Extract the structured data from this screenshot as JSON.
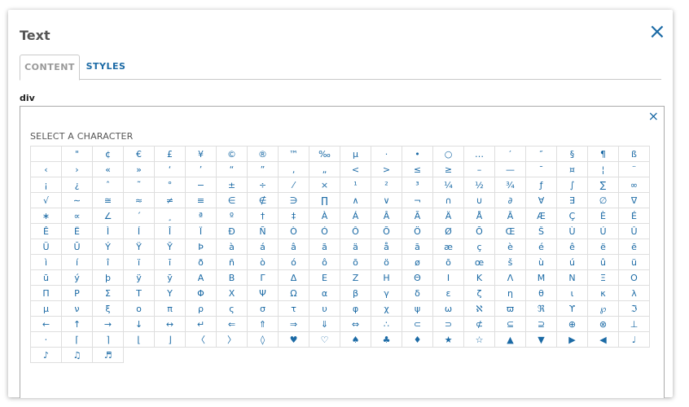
{
  "dialog": {
    "title": "Text",
    "close_icon": "×"
  },
  "tabs": [
    {
      "label": "CONTENT",
      "active": true
    },
    {
      "label": "STYLES",
      "active": false
    }
  ],
  "element_label": "div",
  "picker": {
    "close_icon": "×",
    "heading": "SELECT A CHARACTER",
    "characters": [
      "",
      "\"",
      "¢",
      "€",
      "£",
      "¥",
      "©",
      "®",
      "™",
      "‰",
      "µ",
      "·",
      "•",
      "○",
      "…",
      "′",
      "″",
      "§",
      "¶",
      "ß",
      "‹",
      "›",
      "«",
      "»",
      "‘",
      "’",
      "“",
      "”",
      "‚",
      "„",
      "<",
      ">",
      "≤",
      "≥",
      "–",
      "—",
      "¯",
      "¤",
      "¦",
      "¨",
      "¡",
      "¿",
      "ˆ",
      "˜",
      "°",
      "−",
      "±",
      "÷",
      "⁄",
      "×",
      "¹",
      "²",
      "³",
      "¼",
      "½",
      "¾",
      "ƒ",
      "∫",
      "∑",
      "∞",
      "√",
      "∼",
      "≅",
      "≈",
      "≠",
      "≡",
      "∈",
      "∉",
      "∋",
      "∏",
      "∧",
      "∨",
      "¬",
      "∩",
      "∪",
      "∂",
      "∀",
      "∃",
      "∅",
      "∇",
      "∗",
      "∝",
      "∠",
      "´",
      "¸",
      "ª",
      "º",
      "†",
      "‡",
      "À",
      "Á",
      "Â",
      "Ã",
      "Ä",
      "Å",
      "Ā",
      "Æ",
      "Ç",
      "È",
      "É",
      "Ê",
      "Ë",
      "Ì",
      "Í",
      "Î",
      "Ï",
      "Ð",
      "Ñ",
      "Ò",
      "Ó",
      "Ô",
      "Õ",
      "Ö",
      "Ø",
      "Ō",
      "Œ",
      "Š",
      "Ù",
      "Ú",
      "Û",
      "Ü",
      "Ū",
      "Ý",
      "Ÿ",
      "Ȳ",
      "Þ",
      "à",
      "á",
      "â",
      "ã",
      "ä",
      "å",
      "ā",
      "æ",
      "ç",
      "è",
      "é",
      "ê",
      "ë",
      "ē",
      "ì",
      "í",
      "î",
      "ï",
      "ī",
      "ð",
      "ñ",
      "ò",
      "ó",
      "ô",
      "õ",
      "ö",
      "ø",
      "ō",
      "œ",
      "š",
      "ù",
      "ú",
      "û",
      "ü",
      "ū",
      "ý",
      "þ",
      "ÿ",
      "ȳ",
      "Α",
      "Β",
      "Γ",
      "Δ",
      "Ε",
      "Ζ",
      "Η",
      "Θ",
      "Ι",
      "Κ",
      "Λ",
      "Μ",
      "Ν",
      "Ξ",
      "Ο",
      "Π",
      "Ρ",
      "Σ",
      "Τ",
      "Υ",
      "Φ",
      "Χ",
      "Ψ",
      "Ω",
      "α",
      "β",
      "γ",
      "δ",
      "ε",
      "ζ",
      "η",
      "θ",
      "ι",
      "κ",
      "λ",
      "μ",
      "ν",
      "ξ",
      "ο",
      "π",
      "ρ",
      "ς",
      "σ",
      "τ",
      "υ",
      "φ",
      "χ",
      "ψ",
      "ω",
      "ℵ",
      "ϖ",
      "ℜ",
      "ϒ",
      "℘",
      "ℑ",
      "←",
      "↑",
      "→",
      "↓",
      "↔",
      "↵",
      "⇐",
      "⇑",
      "⇒",
      "⇓",
      "⇔",
      "∴",
      "⊂",
      "⊃",
      "⊄",
      "⊆",
      "⊇",
      "⊕",
      "⊗",
      "⊥",
      "⋅",
      "⌈",
      "⌉",
      "⌊",
      "⌋",
      "〈",
      "〉",
      "◊",
      "♥",
      "♡",
      "♠",
      "♣",
      "♦",
      "★",
      "☆",
      "▲",
      "▼",
      "▶",
      "◀",
      "♩",
      "♪",
      "♫",
      "♬"
    ]
  },
  "colors": {
    "accent": "#1b6aa5",
    "tab_inactive": "#999999",
    "grid_line": "#dedede"
  }
}
